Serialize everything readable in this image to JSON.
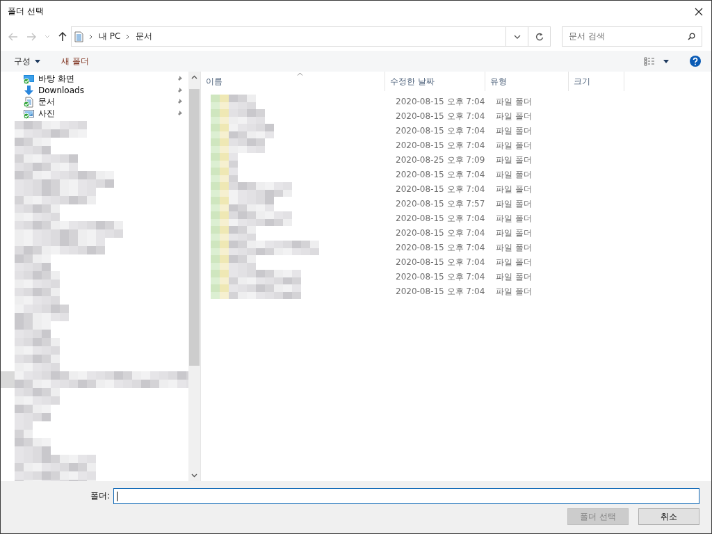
{
  "window": {
    "title": "폴더 선택"
  },
  "address": {
    "path": [
      "내 PC",
      "문서"
    ]
  },
  "search": {
    "placeholder": "문서 검색"
  },
  "toolbar": {
    "organize": "구성",
    "new_folder": "새 폴더"
  },
  "navigation": [
    {
      "kind": "desktop",
      "label": "바탕 화면",
      "pinned": true
    },
    {
      "kind": "downloads",
      "label": "Downloads",
      "pinned": true
    },
    {
      "kind": "documents",
      "label": "문서",
      "pinned": true
    },
    {
      "kind": "pictures",
      "label": "사진",
      "pinned": true
    }
  ],
  "columns": [
    {
      "label": "이름",
      "sorted": true
    },
    {
      "label": "수정한 날짜",
      "sorted": false
    },
    {
      "label": "유형",
      "sorted": false
    },
    {
      "label": "크기",
      "sorted": false
    }
  ],
  "rows": [
    {
      "modified": "2020-08-15 오후 7:04",
      "type": "파일 폴더"
    },
    {
      "modified": "2020-08-15 오후 7:04",
      "type": "파일 폴더"
    },
    {
      "modified": "2020-08-15 오후 7:04",
      "type": "파일 폴더"
    },
    {
      "modified": "2020-08-15 오후 7:04",
      "type": "파일 폴더"
    },
    {
      "modified": "2020-08-25 오후 7:09",
      "type": "파일 폴더"
    },
    {
      "modified": "2020-08-15 오후 7:04",
      "type": "파일 폴더"
    },
    {
      "modified": "2020-08-15 오후 7:04",
      "type": "파일 폴더"
    },
    {
      "modified": "2020-08-15 오후 7:57",
      "type": "파일 폴더"
    },
    {
      "modified": "2020-08-15 오후 7:04",
      "type": "파일 폴더"
    },
    {
      "modified": "2020-08-15 오후 7:04",
      "type": "파일 폴더"
    },
    {
      "modified": "2020-08-15 오후 7:04",
      "type": "파일 폴더"
    },
    {
      "modified": "2020-08-15 오후 7:04",
      "type": "파일 폴더"
    },
    {
      "modified": "2020-08-15 오후 7:04",
      "type": "파일 폴더"
    },
    {
      "modified": "2020-08-15 오후 7:04",
      "type": "파일 폴더"
    }
  ],
  "footer": {
    "folder_label": "폴더:",
    "buttons": [
      {
        "label": "폴더 선택",
        "disabled": true
      },
      {
        "label": "취소",
        "disabled": false
      }
    ]
  }
}
